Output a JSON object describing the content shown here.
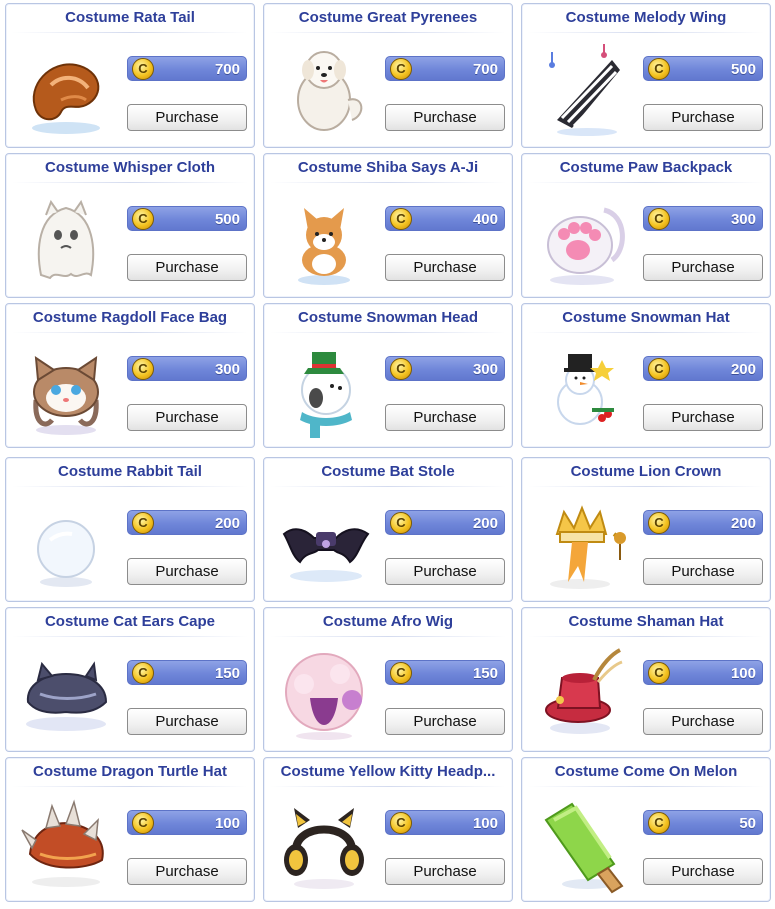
{
  "shop": {
    "items": [
      {
        "name": "Costume Rata Tail",
        "price": "700",
        "button": "Purchase",
        "icon": "squirrel-tail-icon"
      },
      {
        "name": "Costume Great Pyrenees",
        "price": "700",
        "button": "Purchase",
        "icon": "white-dog-icon"
      },
      {
        "name": "Costume Melody Wing",
        "price": "500",
        "button": "Purchase",
        "icon": "piano-wing-icon"
      },
      {
        "name": "Costume Whisper Cloth",
        "price": "500",
        "button": "Purchase",
        "icon": "ghost-cloth-icon"
      },
      {
        "name": "Costume Shiba Says A-Ji",
        "price": "400",
        "button": "Purchase",
        "icon": "corgi-icon"
      },
      {
        "name": "Costume Paw Backpack",
        "price": "300",
        "button": "Purchase",
        "icon": "paw-backpack-icon"
      },
      {
        "name": "Costume Ragdoll Face Bag",
        "price": "300",
        "button": "Purchase",
        "icon": "cat-face-bag-icon"
      },
      {
        "name": "Costume Snowman Head",
        "price": "300",
        "button": "Purchase",
        "icon": "snowman-head-icon"
      },
      {
        "name": "Costume Snowman Hat",
        "price": "200",
        "button": "Purchase",
        "icon": "snowman-hat-icon"
      },
      {
        "name": "Costume Rabbit Tail",
        "price": "200",
        "button": "Purchase",
        "icon": "rabbit-tail-icon"
      },
      {
        "name": "Costume Bat Stole",
        "price": "200",
        "button": "Purchase",
        "icon": "bat-stole-icon"
      },
      {
        "name": "Costume Lion Crown",
        "price": "200",
        "button": "Purchase",
        "icon": "lion-crown-icon"
      },
      {
        "name": "Costume Cat Ears Cape",
        "price": "150",
        "button": "Purchase",
        "icon": "cat-ears-cape-icon"
      },
      {
        "name": "Costume Afro Wig",
        "price": "150",
        "button": "Purchase",
        "icon": "afro-wig-icon"
      },
      {
        "name": "Costume Shaman Hat",
        "price": "100",
        "button": "Purchase",
        "icon": "shaman-hat-icon"
      },
      {
        "name": "Costume Dragon Turtle Hat",
        "price": "100",
        "button": "Purchase",
        "icon": "dragon-turtle-hat-icon"
      },
      {
        "name": "Costume Yellow Kitty Headp...",
        "price": "100",
        "button": "Purchase",
        "icon": "kitty-headphones-icon"
      },
      {
        "name": "Costume Come On Melon",
        "price": "50",
        "button": "Purchase",
        "icon": "melon-popsicle-icon"
      }
    ]
  },
  "colors": {
    "title": "#2e3f9a",
    "price_bar": "#6f86d9",
    "card_border": "#b9c6e3",
    "coin": "#f4c320"
  },
  "currency_icon": "coin-icon"
}
